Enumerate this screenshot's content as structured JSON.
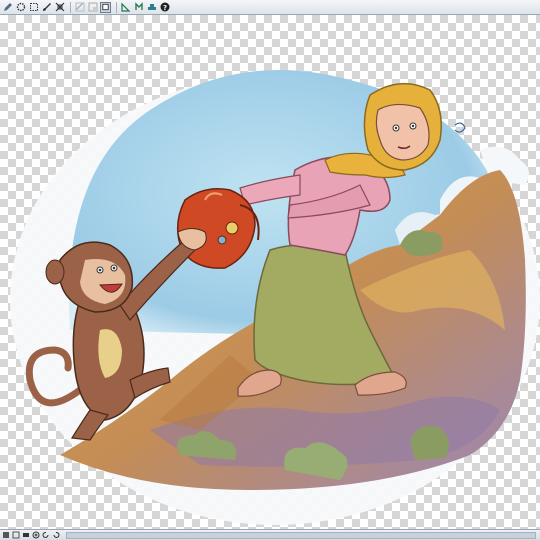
{
  "toolbar": {
    "buttons": [
      {
        "name": "pencil-icon"
      },
      {
        "name": "lasso-select-icon"
      },
      {
        "name": "marquee-select-icon"
      },
      {
        "name": "brush-icon"
      },
      {
        "name": "transform-icon"
      },
      {
        "name": "layer-icon"
      },
      {
        "name": "layer-mask-icon"
      },
      {
        "name": "active-layer-icon"
      },
      {
        "name": "ruler-icon"
      },
      {
        "name": "eraser-icon"
      },
      {
        "name": "stamp-icon"
      },
      {
        "name": "help-icon"
      }
    ]
  },
  "statusbar": {
    "buttons": [
      {
        "name": "page-first-icon"
      },
      {
        "name": "page-prev-icon"
      },
      {
        "name": "zoom-out-icon"
      },
      {
        "name": "zoom-in-icon"
      },
      {
        "name": "rotate-left-icon"
      },
      {
        "name": "rotate-right-icon"
      }
    ]
  },
  "colors": {
    "sky": "#a9d6ea",
    "mountain": "#c99a55",
    "dress": "#9aa35b",
    "blouse": "#e7a0b2",
    "scarf": "#e6b23a",
    "monkey": "#9c6248",
    "pot": "#cf4a24"
  }
}
